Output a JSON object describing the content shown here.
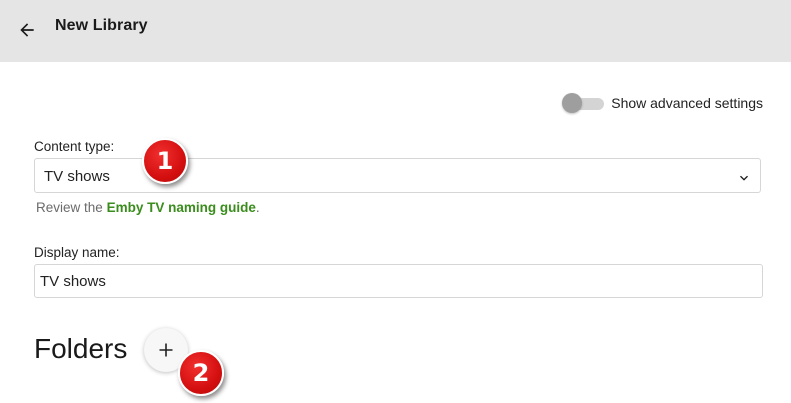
{
  "header": {
    "title": "New Library",
    "back_icon": "arrow-left-icon",
    "background": "#e5e5e5"
  },
  "advanced_toggle": {
    "label": "Show advanced settings",
    "enabled": false
  },
  "content_type": {
    "label": "Content type:",
    "selected": "TV shows",
    "dropdown_icon": "chevron-down-icon"
  },
  "hint": {
    "prefix": "Review the",
    "link_text": "Emby TV naming guide",
    "suffix": ".",
    "link_color": "#3a8d1d"
  },
  "display_name": {
    "label": "Display name:",
    "value": "TV shows"
  },
  "folders": {
    "title": "Folders",
    "add_icon": "plus-icon"
  },
  "callouts": {
    "one": "1",
    "two": "2",
    "color": "#d40f0f"
  }
}
